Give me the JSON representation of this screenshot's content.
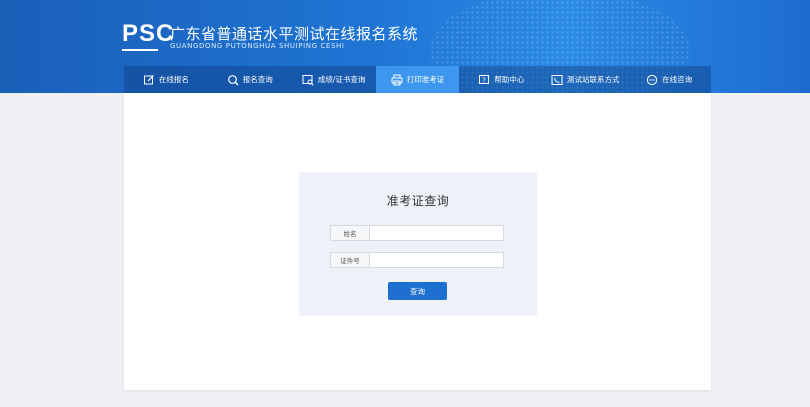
{
  "header": {
    "logo_text": "PSC",
    "title": "广东省普通话水平测试在线报名系统",
    "subtitle": "GUANGDONG PUTONGHUA SHUIPING CESHI"
  },
  "nav": {
    "items": [
      {
        "label": "在线报名",
        "icon": "edit-icon"
      },
      {
        "label": "报名查询",
        "icon": "search-icon"
      },
      {
        "label": "成绩/证书查询",
        "icon": "certificate-search-icon"
      },
      {
        "label": "打印准考证",
        "icon": "printer-icon",
        "active": true
      },
      {
        "label": "帮助中心",
        "icon": "help-icon"
      },
      {
        "label": "测试站联系方式",
        "icon": "contact-card-icon"
      },
      {
        "label": "在线咨询",
        "icon": "chat-icon"
      }
    ]
  },
  "form": {
    "title": "准考证查询",
    "name_label": "姓名",
    "name_value": "",
    "id_label": "证件号",
    "id_value": "",
    "submit_label": "查询"
  },
  "colors": {
    "header_blue": "#1f74d3",
    "nav_active": "#3d97ee",
    "button_blue": "#1e6fd0"
  }
}
